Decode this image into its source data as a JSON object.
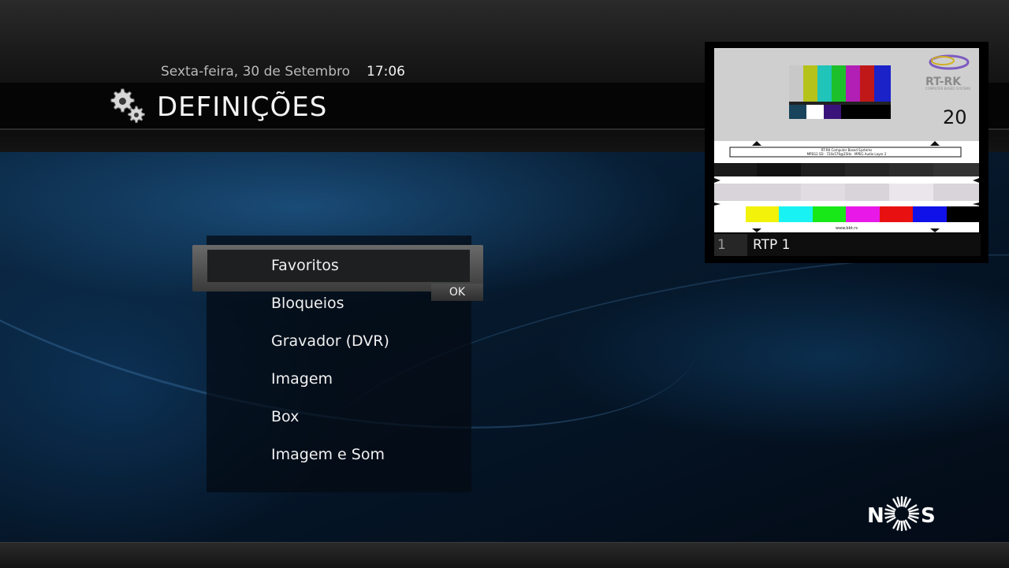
{
  "header": {
    "date": "Sexta-feira, 30 de Setembro",
    "time": "17:06",
    "title": "DEFINIÇÕES",
    "icon": "gear-icon"
  },
  "menu": {
    "items": [
      {
        "label": "Favoritos",
        "selected": true
      },
      {
        "label": "Bloqueios",
        "selected": false
      },
      {
        "label": "Gravador (DVR)",
        "selected": false
      },
      {
        "label": "Imagem",
        "selected": false
      },
      {
        "label": "Box",
        "selected": false
      },
      {
        "label": "Imagem e Som",
        "selected": false
      }
    ],
    "ok_label": "OK"
  },
  "preview": {
    "channel_number": "1",
    "channel_name": "RTP 1",
    "test_card": {
      "brand": "RT-RK",
      "brand_sub": "COMPUTER BASED SYSTEMS",
      "number": "20",
      "caption_line1": "RT-RK Computer Based Systems",
      "caption_line2": "MPEG2 SD · 720x576@25Hz · MPEG Audio Layer 2",
      "footer_url": "www.bbt.rs"
    }
  },
  "brand": {
    "logo_left": "N",
    "logo_right": "S"
  },
  "colors": {
    "background_blue": "#061a2e",
    "selection_frame": "#5a5a5a",
    "text": "#f0f0f0"
  }
}
